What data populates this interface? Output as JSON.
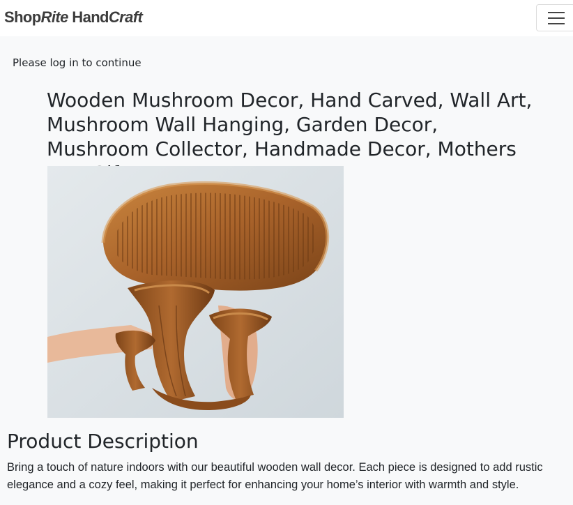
{
  "brand": {
    "part1": "Shop",
    "part2": "Rite",
    "part3": "Hand",
    "part4": "Craft"
  },
  "navbar": {
    "menu_icon": "hamburger-menu-icon"
  },
  "notice": {
    "login_message": "Please log in to continue"
  },
  "product": {
    "title": "Wooden Mushroom Decor, Hand Carved, Wall Art, Mushroom Wall Hanging, Garden Decor, Mushroom Collector, Handmade Decor, Mothers Day Gift",
    "description_heading": "Product Description",
    "description": "Bring a touch of nature indoors with our beautiful wooden wall decor. Each piece is designed to add rustic elegance and a cozy feel, making it perfect for enhancing your home’s interior with warmth and style."
  },
  "colors": {
    "page_bg": "#f8f9fa",
    "navbar_bg": "#ffffff",
    "text": "#212529",
    "wood": "#a8622a"
  }
}
